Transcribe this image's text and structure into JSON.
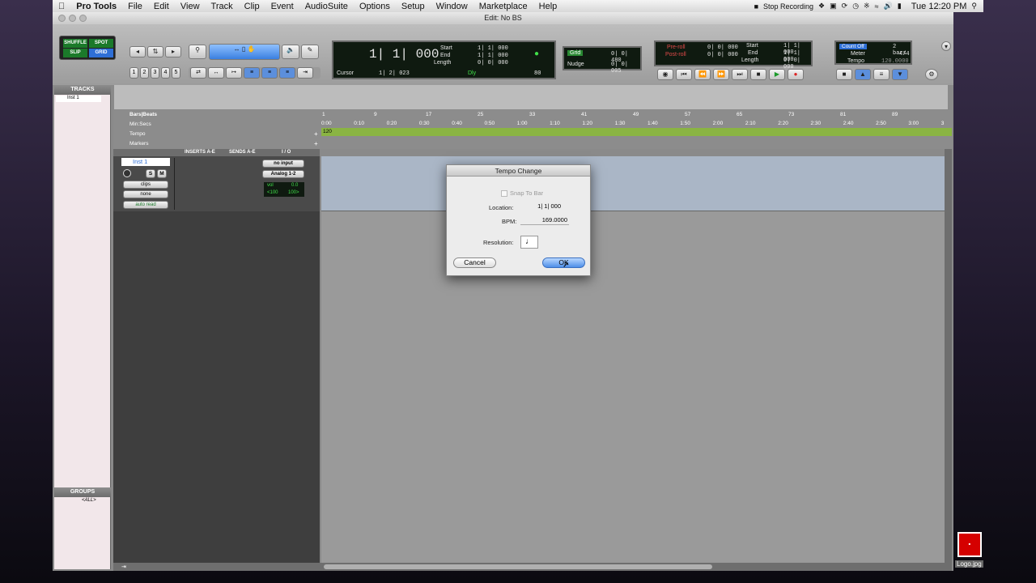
{
  "menubar": {
    "app": "Pro Tools",
    "items": [
      "File",
      "Edit",
      "View",
      "Track",
      "Clip",
      "Event",
      "AudioSuite",
      "Options",
      "Setup",
      "Window",
      "Marketplace",
      "Help"
    ],
    "stop_recording": "Stop Recording",
    "clock": "Tue 12:20 PM"
  },
  "window": {
    "title": "Edit: No BS"
  },
  "edit_modes": {
    "shuffle": "SHUFFLE",
    "spot": "SPOT",
    "slip": "SLIP",
    "grid": "GRID"
  },
  "zoom_presets": [
    "1",
    "2",
    "3",
    "4",
    "5"
  ],
  "counter": {
    "main": "1| 1| 000",
    "start_label": "Start",
    "start": "1| 1| 000",
    "end_label": "End",
    "end": "1| 1| 000",
    "length_label": "Length",
    "length": "0| 0| 000",
    "cursor_label": "Cursor",
    "cursor": "1| 2| 023",
    "dly": "Dly",
    "tempo_field": "80"
  },
  "grid_nudge": {
    "grid_label": "Grid",
    "grid": "0| 0| 480",
    "nudge_label": "Nudge",
    "nudge": "0| 0| 005"
  },
  "transport": {
    "preroll_label": "Pre-roll",
    "preroll": "0| 0| 000",
    "postroll_label": "Post-roll",
    "postroll": "0| 0| 000",
    "start_label": "Start",
    "start": "1| 1| 000",
    "end_label": "End",
    "end": "1| 1| 000",
    "length_label": "Length",
    "length": "0| 0| 000"
  },
  "midi": {
    "count_off": "Count Off",
    "bars": "2 bars",
    "meter_label": "Meter",
    "meter": "4/4",
    "tempo_label": "Tempo",
    "tempo": "120.0000"
  },
  "tracks_panel": {
    "title": "TRACKS",
    "items": [
      "Inst 1"
    ]
  },
  "groups_panel": {
    "title": "GROUPS",
    "items": [
      "<ALL>"
    ]
  },
  "rulers": {
    "bars_label": "Bars|Beats",
    "min_label": "Min:Secs",
    "tempo_label": "Tempo",
    "markers_label": "Markers",
    "bars": [
      "1",
      "9",
      "17",
      "25",
      "33",
      "41",
      "49",
      "57",
      "65",
      "73",
      "81",
      "89"
    ],
    "secs": [
      "0:00",
      "0:10",
      "0:20",
      "0:30",
      "0:40",
      "0:50",
      "1:00",
      "1:10",
      "1:20",
      "1:30",
      "1:40",
      "1:50",
      "2:00",
      "2:10",
      "2:20",
      "2:30",
      "2:40",
      "2:50",
      "3:00",
      "3"
    ],
    "tempo_value": "120"
  },
  "io_header": {
    "inserts": "INSERTS A-E",
    "sends": "SENDS A-E",
    "io": "I / O"
  },
  "track": {
    "name": "Inst 1",
    "clips": "clips",
    "none": "none",
    "auto": "auto read",
    "input": "no input",
    "output": "Analog 1-2",
    "vol_label": "vol",
    "vol": "0.0",
    "pan_l": "<100",
    "pan_r": "100>",
    "solo": "S",
    "mute": "M"
  },
  "dialog": {
    "title": "Tempo Change",
    "snap_label": "Snap To Bar",
    "location_label": "Location:",
    "location": "1| 1| 000",
    "bpm_label": "BPM:",
    "bpm": "169.0000",
    "resolution_label": "Resolution:",
    "resolution": "♩",
    "cancel": "Cancel",
    "ok": "OK"
  },
  "logo": {
    "caption": "Logo.jpg"
  },
  "colors": {
    "accent": "#41e04a",
    "tempo_ruler": "#8ab443",
    "dialog_ok": "#6aa2e8"
  }
}
